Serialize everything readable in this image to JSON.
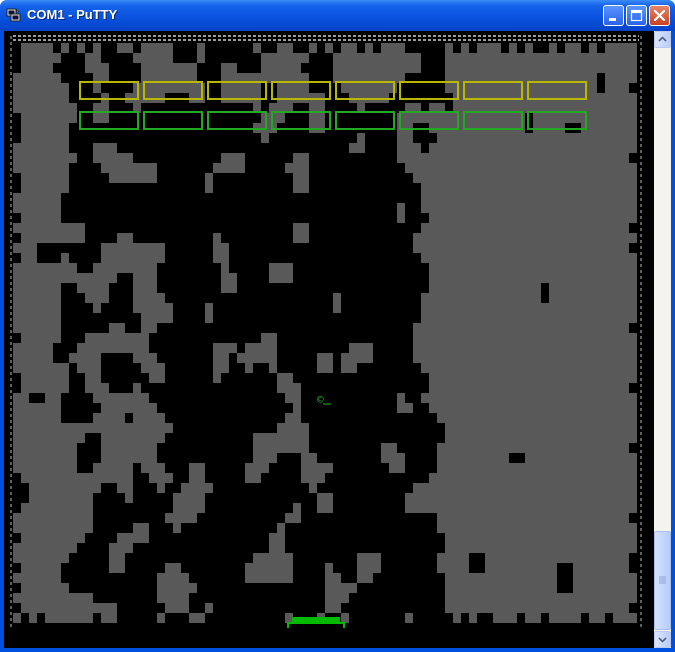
{
  "window": {
    "title": "COM1 - PuTTY",
    "app_icon": "putty-icon",
    "buttons": {
      "minimize": "minimize-icon",
      "maximize": "maximize-icon",
      "close": "close-icon"
    }
  },
  "game": {
    "name_icon": "breakout-game",
    "brick_rows": [
      {
        "color": "#b8b800",
        "count": 8
      },
      {
        "color": "#22a822",
        "count": 8
      }
    ],
    "ball_glyph": "©",
    "ball_color": "#22bb22",
    "paddle_color": "#00bb00",
    "background_colors": {
      "dark": "#000000",
      "light": "#595959"
    }
  },
  "scrollbar": {
    "up_icon": "scroll-up-icon",
    "down_icon": "scroll-down-icon"
  }
}
